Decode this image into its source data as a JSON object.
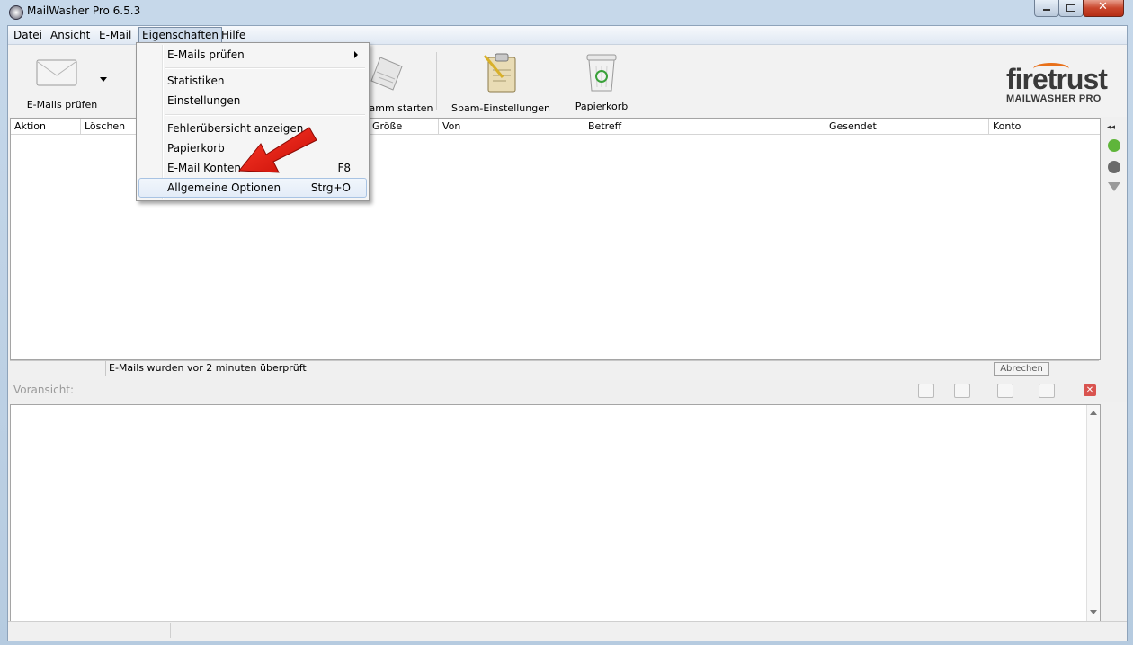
{
  "window": {
    "title": "MailWasher Pro 6.5.3"
  },
  "menubar": {
    "items": [
      "Datei",
      "Ansicht",
      "E-Mail",
      "Eigenschaften",
      "Hilfe"
    ]
  },
  "toolbar": {
    "check_label": "E-Mails prüfen",
    "program_label": "gramm starten",
    "spam_label": "Spam-Einstellungen",
    "trash_label": "Papierkorb"
  },
  "brand": {
    "name": "firetrust",
    "product": "MAILWASHER PRO",
    "colors": {
      "primary": "#3a3a3a",
      "accent": "#e8701a"
    }
  },
  "list": {
    "columns": [
      "Aktion",
      "Löschen",
      "Größe",
      "Von",
      "Betreff",
      "Gesendet",
      "Konto"
    ]
  },
  "status": {
    "text": "E-Mails wurden vor 2 minuten überprüft",
    "cancel": "Abrechen"
  },
  "preview": {
    "label": "Voransicht:"
  },
  "dropdown": {
    "items": [
      {
        "label": "E-Mails prüfen",
        "shortcut": "",
        "submenu": true
      },
      {
        "label": "Statistiken",
        "shortcut": ""
      },
      {
        "label": "Einstellungen",
        "shortcut": ""
      },
      {
        "label": "Fehlerübersicht anzeigen",
        "shortcut": ""
      },
      {
        "label": "Papierkorb",
        "shortcut": ""
      },
      {
        "label": "E-Mail Konten",
        "shortcut": "F8"
      },
      {
        "label": "Allgemeine Optionen",
        "shortcut": "Strg+O",
        "highlighted": true
      }
    ]
  },
  "annotation": {
    "color": "#e0190f"
  }
}
